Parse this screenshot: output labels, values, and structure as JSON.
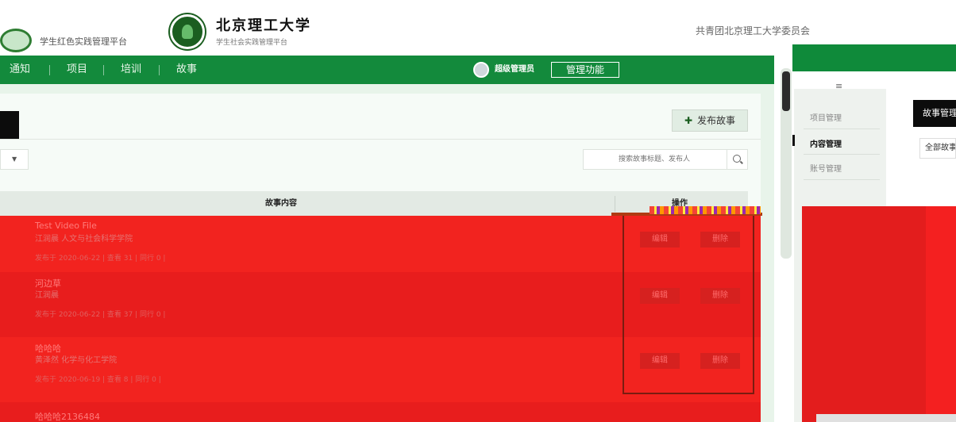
{
  "header": {
    "system_name": "学生红色实践管理平台",
    "university_name": "北京理工大学",
    "university_sub": "学生社会实践管理平台",
    "org_text": "共青团北京理工大学委员会"
  },
  "nav": {
    "items": [
      "通知",
      "项目",
      "培训",
      "故事"
    ],
    "admin_label": "超级管理员",
    "management_button": "管理功能"
  },
  "toolbar": {
    "publish_button": "发布故事",
    "search_placeholder": "搜索故事标题、发布人"
  },
  "table": {
    "columns": [
      "故事内容",
      "操作"
    ],
    "rows": [
      {
        "title": "Test Video File",
        "author": "江润晨 人文与社会科学学院",
        "meta": "发布于 2020-06-22 | 查看 31 | 同行 0 |",
        "edit": "编辑",
        "delete": "删除"
      },
      {
        "title": "河边草",
        "author": "江润晨",
        "meta": "发布于 2020-06-22 | 查看 37 | 同行 0 |",
        "edit": "编辑",
        "delete": "删除"
      },
      {
        "title": "哈哈哈",
        "author": "黄泽然 化学与化工学院",
        "meta": "发布于 2020-06-19 | 查看 8 | 同行 0 |",
        "edit": "编辑",
        "delete": "删除"
      },
      {
        "title": "哈哈哈2136484"
      }
    ]
  },
  "right_panel": {
    "menu": [
      "项目管理",
      "内容管理",
      "账号管理"
    ],
    "tab_title": "故事管理",
    "filter_value": "全部故事"
  },
  "colors": {
    "nav_green": "#138a3c",
    "overlay_red": "#e31d1d",
    "row_red_alt": "#f2231f"
  }
}
